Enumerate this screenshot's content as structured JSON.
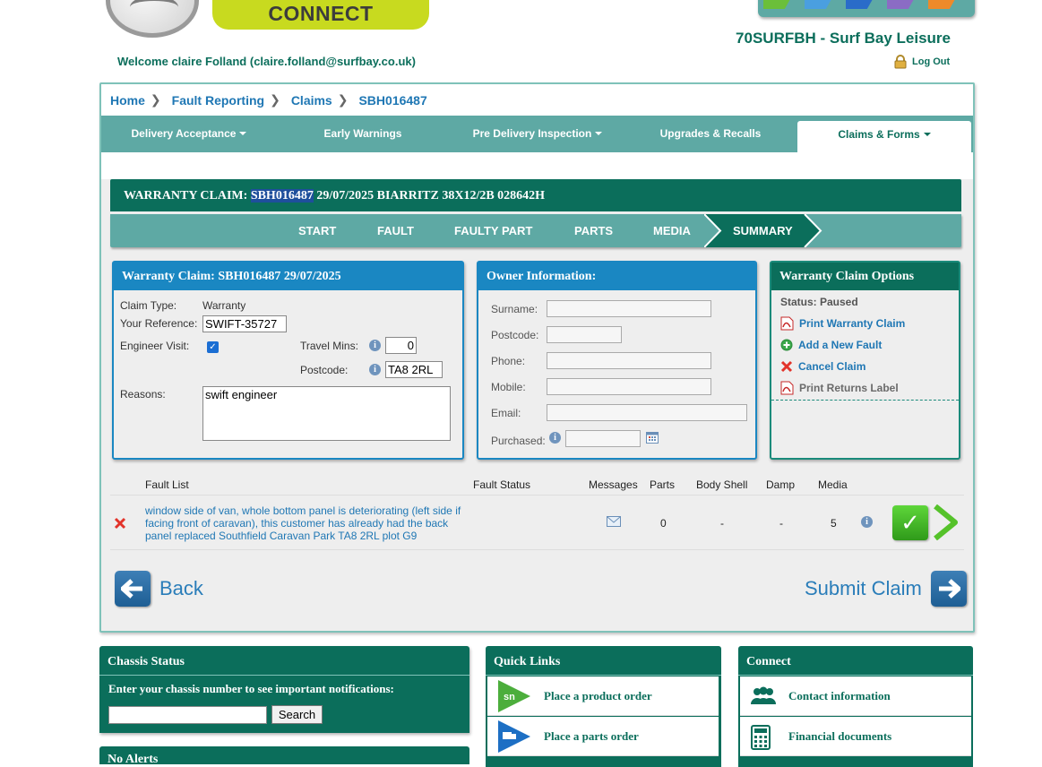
{
  "header": {
    "connect_label": "CONNECT",
    "dealer": "70SURFBH - Surf Bay Leisure",
    "welcome": "Welcome claire Folland (claire.folland@surfbay.co.uk)",
    "logout": "Log Out",
    "brand_colors": [
      "#6bbf3a",
      "#4a9fe0",
      "#2a6cc9",
      "#8b6cc4",
      "#ee8a2a"
    ]
  },
  "breadcrumb": [
    "Home",
    "Fault Reporting",
    "Claims",
    "SBH016487"
  ],
  "nav": {
    "delivery": "Delivery Acceptance",
    "early": "Early Warnings",
    "pdi": "Pre Delivery Inspection",
    "upgrades": "Upgrades & Recalls",
    "claims": "Claims & Forms"
  },
  "claim_title": {
    "prefix": "WARRANTY CLAIM:",
    "ref": "SBH016487",
    "rest": "29/07/2025 BIARRITZ 38X12/2B 028642H"
  },
  "steps": [
    "START",
    "FAULT",
    "FAULTY PART",
    "PARTS",
    "MEDIA",
    "SUMMARY"
  ],
  "claim_box": {
    "title": "Warranty Claim: SBH016487 29/07/2025",
    "claim_type_label": "Claim Type:",
    "claim_type": "Warranty",
    "your_ref_label": "Your Reference:",
    "your_ref": "SWIFT-35727",
    "engineer_label": "Engineer Visit:",
    "engineer_checked": true,
    "travel_label": "Travel Mins:",
    "travel_mins": "0",
    "postcode_label": "Postcode:",
    "postcode": "TA8 2RL",
    "reasons_label": "Reasons:",
    "reasons": "swift engineer"
  },
  "owner_box": {
    "title": "Owner Information:",
    "surname": "Surname:",
    "postcode": "Postcode:",
    "phone": "Phone:",
    "mobile": "Mobile:",
    "email": "Email:",
    "purchased": "Purchased:"
  },
  "options_box": {
    "title": "Warranty Claim Options",
    "status": "Status: Paused",
    "print": "Print Warranty Claim",
    "add": "Add a New Fault",
    "cancel": "Cancel Claim",
    "returns": "Print Returns Label"
  },
  "fault_list": {
    "headers": {
      "list": "Fault List",
      "status": "Fault Status",
      "messages": "Messages",
      "parts": "Parts",
      "body": "Body Shell",
      "damp": "Damp",
      "media": "Media"
    },
    "rows": [
      {
        "description": "window side of van, whole bottom panel is deteriorating (left side if facing front of caravan), this customer has already had the back panel replaced Southfield Caravan Park TA8 2RL plot G9",
        "parts": "0",
        "body": "-",
        "damp": "-",
        "media": "5"
      }
    ]
  },
  "actions": {
    "back": "Back",
    "submit": "Submit Claim"
  },
  "chassis": {
    "title": "Chassis Status",
    "prompt": "Enter your chassis number to see important notifications:",
    "search": "Search"
  },
  "alerts": {
    "title": "No Alerts"
  },
  "quick_links": {
    "title": "Quick Links",
    "items": [
      "Place a product order",
      "Place a parts order"
    ]
  },
  "connect": {
    "title": "Connect",
    "items": [
      "Contact information",
      "Financial documents"
    ]
  }
}
